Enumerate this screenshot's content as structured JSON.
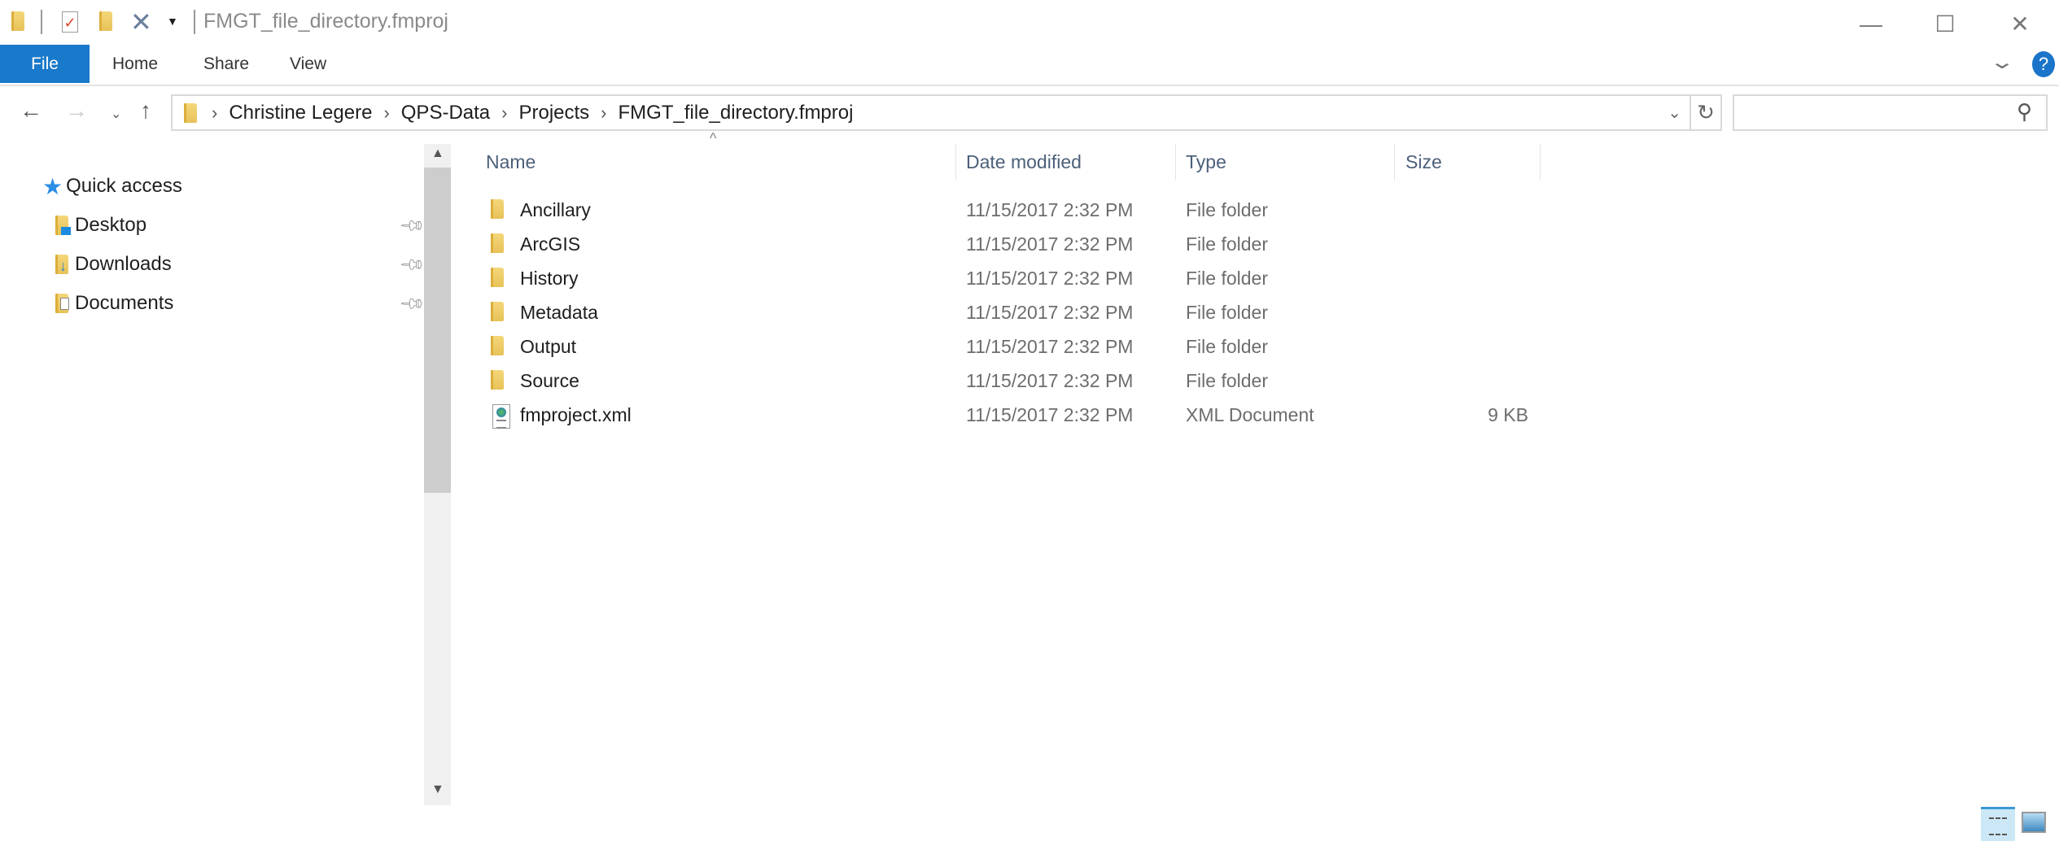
{
  "window": {
    "title": "FMGT_file_directory.fmproj",
    "minimize": "—",
    "maximize": "☐",
    "close": "✕"
  },
  "ribbon": {
    "tabs": [
      {
        "label": "File"
      },
      {
        "label": "Home"
      },
      {
        "label": "Share"
      },
      {
        "label": "View"
      }
    ],
    "help": "?"
  },
  "address": {
    "crumbs": [
      "Christine Legere",
      "QPS-Data",
      "Projects",
      "FMGT_file_directory.fmproj"
    ],
    "search_placeholder": ""
  },
  "sidebar": {
    "quick_access": "Quick access",
    "items": [
      {
        "label": "Desktop"
      },
      {
        "label": "Downloads"
      },
      {
        "label": "Documents"
      }
    ]
  },
  "columns": {
    "name": "Name",
    "date": "Date modified",
    "type": "Type",
    "size": "Size"
  },
  "files": [
    {
      "name": "Ancillary",
      "date": "11/15/2017 2:32 PM",
      "type": "File folder",
      "size": "",
      "icon": "folder"
    },
    {
      "name": "ArcGIS",
      "date": "11/15/2017 2:32 PM",
      "type": "File folder",
      "size": "",
      "icon": "folder"
    },
    {
      "name": "History",
      "date": "11/15/2017 2:32 PM",
      "type": "File folder",
      "size": "",
      "icon": "folder"
    },
    {
      "name": "Metadata",
      "date": "11/15/2017 2:32 PM",
      "type": "File folder",
      "size": "",
      "icon": "folder"
    },
    {
      "name": "Output",
      "date": "11/15/2017 2:32 PM",
      "type": "File folder",
      "size": "",
      "icon": "folder"
    },
    {
      "name": "Source",
      "date": "11/15/2017 2:32 PM",
      "type": "File folder",
      "size": "",
      "icon": "folder"
    },
    {
      "name": "fmproject.xml",
      "date": "11/15/2017 2:32 PM",
      "type": "XML Document",
      "size": "9 KB",
      "icon": "xml"
    }
  ]
}
